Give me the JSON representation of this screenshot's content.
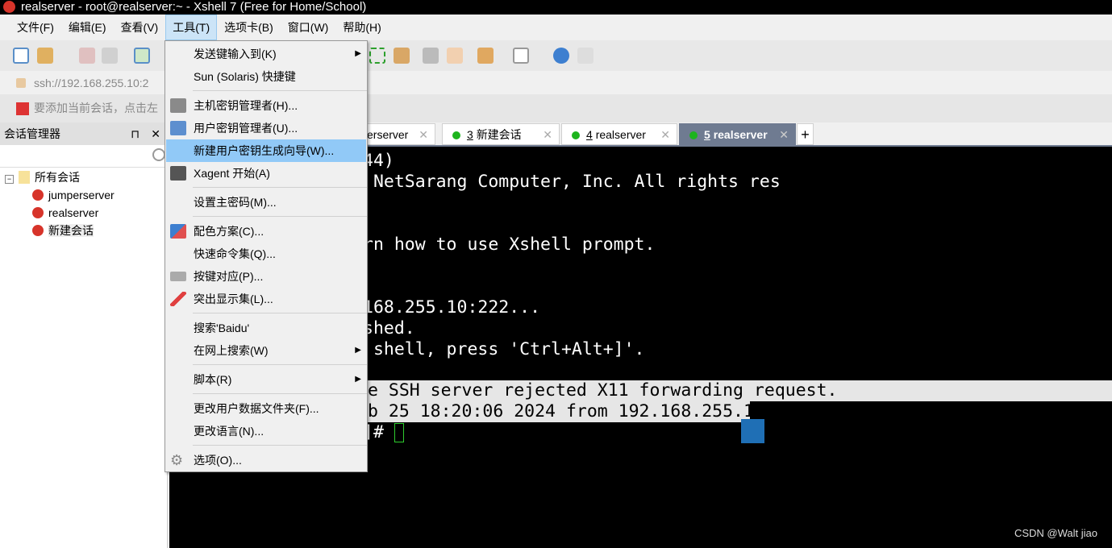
{
  "window": {
    "title": "realserver - root@realserver:~ - Xshell 7 (Free for Home/School)"
  },
  "menubar": [
    "文件(F)",
    "编辑(E)",
    "查看(V)",
    "工具(T)",
    "选项卡(B)",
    "窗口(W)",
    "帮助(H)"
  ],
  "address": "ssh://192.168.255.10:2",
  "infobar": "要添加当前会话，点击左",
  "sidebar": {
    "title": "会话管理器",
    "root": "所有会话",
    "sessions": [
      "jumperserver",
      "realserver",
      "新建会话"
    ]
  },
  "tabs": [
    {
      "num": "",
      "label": "erserver",
      "active": false
    },
    {
      "num": "3",
      "label": "新建会话",
      "active": false
    },
    {
      "num": "4",
      "label": "realserver",
      "active": false
    },
    {
      "num": "5",
      "label": "realserver",
      "active": true
    }
  ],
  "tab_add": "+",
  "terminal": {
    "lines": [
      "44)",
      " NetSarang Computer, Inc. All rights res",
      "rn how to use Xshell prompt.",
      "168.255.10:222...",
      "shed.",
      " shell, press 'Ctrl+Alt+]'.",
      "e SSH server rejected X11 forwarding request.",
      "b 25 18:20:06 2024 from 192.168.255.1",
      "]# "
    ]
  },
  "tools_menu": {
    "items": [
      "发送键输入到(K)",
      "Sun (Solaris) 快捷键",
      "主机密钥管理者(H)...",
      "用户密钥管理者(U)...",
      "新建用户密钥生成向导(W)...",
      "Xagent 开始(A)",
      "设置主密码(M)...",
      "配色方案(C)...",
      "快速命令集(Q)...",
      "按键对应(P)...",
      "突出显示集(L)...",
      "搜索'Baidu'",
      "在网上搜索(W)",
      "脚本(R)",
      "更改用户数据文件夹(F)...",
      "更改语言(N)...",
      "选项(O)..."
    ],
    "highlighted": "新建用户密钥生成向导(W)..."
  },
  "watermark": "CSDN @Walt jiao"
}
